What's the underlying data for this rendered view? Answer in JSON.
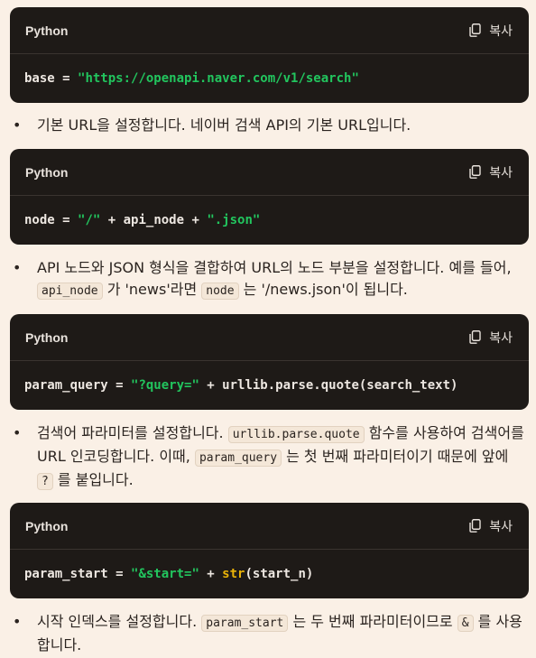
{
  "blocks": [
    {
      "lang": "Python",
      "copy_label": "복사",
      "code": {
        "v1": "base",
        "o1": " = ",
        "s1": "\"https://openapi.naver.com/v1/search\""
      }
    },
    {
      "lang": "Python",
      "copy_label": "복사",
      "code": {
        "v1": "node",
        "o1": " = ",
        "s1": "\"/\"",
        "o2": " + api_node + ",
        "s2": "\".json\""
      }
    },
    {
      "lang": "Python",
      "copy_label": "복사",
      "code": {
        "v1": "param_query",
        "o1": " = ",
        "s1": "\"?query=\"",
        "o2": " + urllib.parse.quote(search_text)"
      }
    },
    {
      "lang": "Python",
      "copy_label": "복사",
      "code": {
        "v1": "param_start",
        "o1": " = ",
        "s1": "\"&start=\"",
        "o2": " + ",
        "f1": "str",
        "o3": "(start_n)"
      }
    }
  ],
  "bullets": {
    "b1": {
      "t1": "기본 URL을 설정합니다. 네이버 검색 API의 기본 URL입니다."
    },
    "b2": {
      "t1": "API 노드와 JSON 형식을 결합하여 URL의 노드 부분을 설정합니다. 예를 들어, ",
      "c1": "api_node",
      "t2": " 가 'news'라면 ",
      "c2": "node",
      "t3": " 는 '/news.json'이 됩니다."
    },
    "b3": {
      "t1": "검색어 파라미터를 설정합니다. ",
      "c1": "urllib.parse.quote",
      "t2": " 함수를 사용하여 검색어를 URL 인코딩합니다. 이때, ",
      "c2": "param_query",
      "t3": " 는 첫 번째 파라미터이기 때문에 앞에 ",
      "c3": "?",
      "t4": " 를 붙입니다."
    },
    "b4": {
      "t1": "시작 인덱스를 설정합니다. ",
      "c1": "param_start",
      "t2": " 는 두 번째 파라미터이므로 ",
      "c2": "&",
      "t3": " 를 사용합니다."
    }
  }
}
